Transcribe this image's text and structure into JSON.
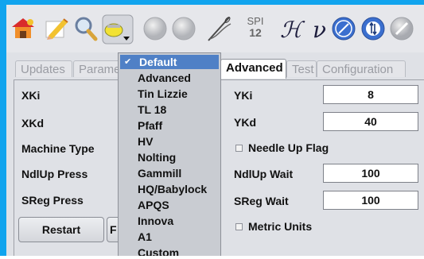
{
  "toolbar": {
    "spi_label": "SPI",
    "spi_value": "12",
    "script_h": "ℋ",
    "script_v": "ν",
    "icons": [
      "home-tools-icon",
      "edit-pencil-icon",
      "magnifier-icon",
      "thread-spool-dropdown-icon",
      "gray-circle-icon",
      "gray-circle-icon",
      "needle-thread-icon",
      "script-h-icon",
      "script-v-icon",
      "blue-gauge-icon",
      "blue-tension-icon",
      "gray-pen-icon"
    ]
  },
  "tabs": [
    "Updates",
    "Parame",
    "Advanced",
    "Test",
    "Configuration"
  ],
  "active_tab": "Advanced",
  "left_fields": {
    "xki": "XKi",
    "xkd": "XKd",
    "machine_type": "Machine Type",
    "ndlup_press": "NdlUp Press",
    "sreg_press": "SReg Press"
  },
  "right_fields": {
    "yki_label": "YKi",
    "yki_value": "8",
    "ykd_label": "YKd",
    "ykd_value": "40",
    "needle_up_flag": "Needle Up Flag",
    "ndlup_wait_label": "NdlUp Wait",
    "ndlup_wait_value": "100",
    "sreg_wait_label": "SReg Wait",
    "sreg_wait_value": "100",
    "metric_units": "Metric Units"
  },
  "buttons": {
    "restart": "Restart",
    "partial": "F"
  },
  "dropdown": {
    "selected": "Default",
    "options": [
      "Advanced",
      "Tin Lizzie",
      "TL 18",
      "Pfaff",
      "HV",
      "Nolting",
      "Gammill",
      "HQ/Babylock",
      "APQS",
      "Innova",
      "A1",
      "Custom"
    ]
  }
}
